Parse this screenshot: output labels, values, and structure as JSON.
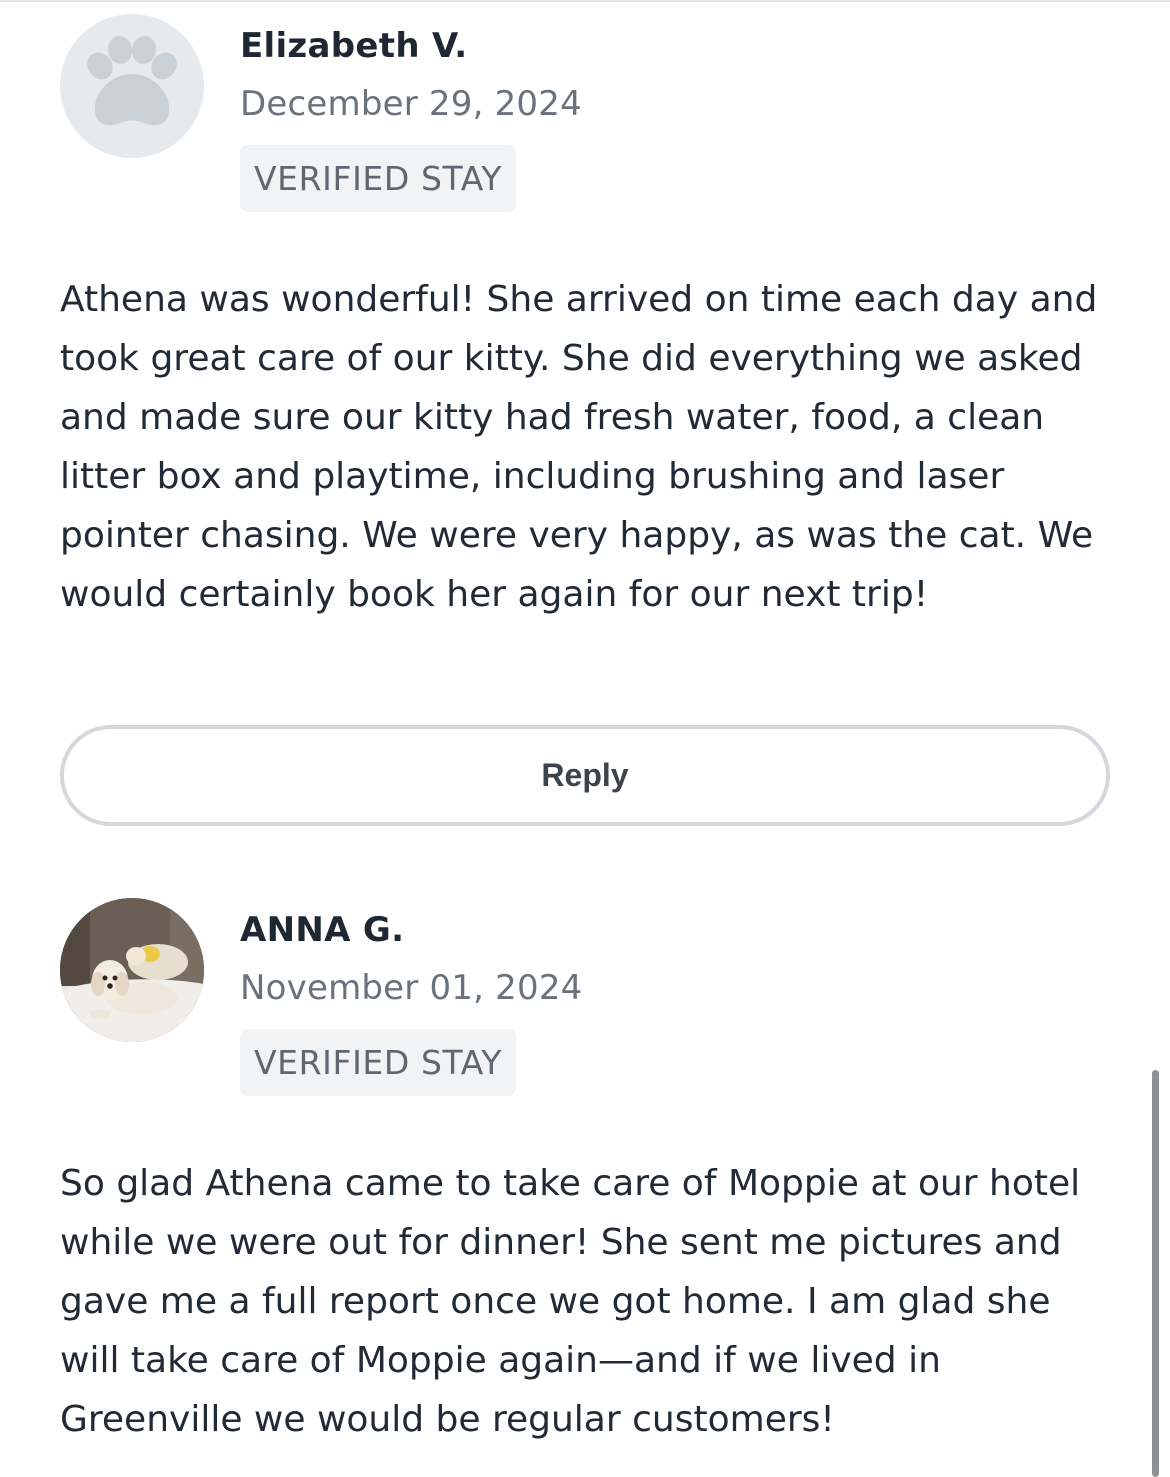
{
  "reviews": [
    {
      "name": "Elizabeth V.",
      "date": "December 29, 2024",
      "badge": "VERIFIED STAY",
      "avatar_icon": "paw-icon",
      "text": "Athena was wonderful! She arrived on time each day and took great care of our kitty. She did everything we asked and made sure our kitty had fresh water, food, a clean litter box and playtime, including brushing and laser pointer chasing. We were very happy, as was the cat. We would certainly book her again for our next trip!",
      "reply_label": "Reply"
    },
    {
      "name": "ANNA G.",
      "date": "November 01, 2024",
      "badge": "VERIFIED STAY",
      "avatar_icon": "dog-photo",
      "text": "So glad Athena came to take care of Moppie at our hotel while we were out for dinner! She sent me pictures and gave me a full report once we got home.  I am glad she will take care of Moppie again—and if we lived in Greenville we would be regular customers!"
    }
  ],
  "colors": {
    "text": "#222a35",
    "muted": "#6a727c",
    "badge_bg": "#f1f3f5",
    "border": "#d4d7db",
    "paw": "#c9d0d6"
  }
}
